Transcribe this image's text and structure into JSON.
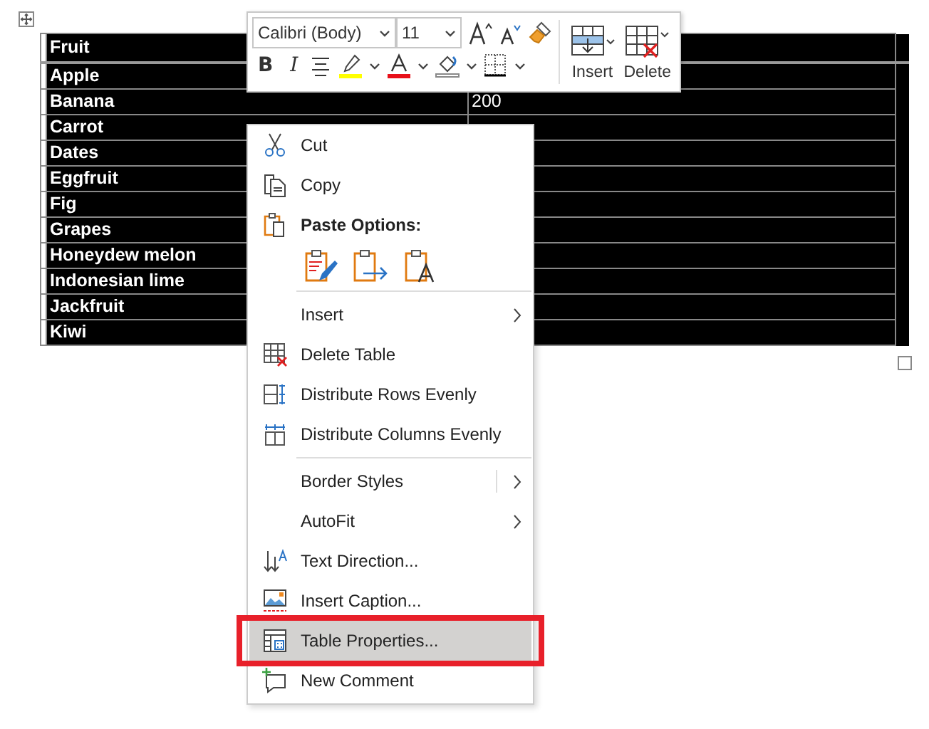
{
  "table": {
    "selected": true,
    "rows": [
      {
        "label": "Fruit",
        "header": true
      },
      {
        "label": "Apple",
        "header": false
      },
      {
        "label": "Banana",
        "header": false,
        "column_2": "200"
      },
      {
        "label": "Carrot",
        "header": false
      },
      {
        "label": "Dates",
        "header": false
      },
      {
        "label": "Eggfruit",
        "header": false
      },
      {
        "label": "Fig",
        "header": false
      },
      {
        "label": "Grapes",
        "header": false
      },
      {
        "label": "Honeydew melon",
        "header": false
      },
      {
        "label": "Indonesian lime",
        "header": false
      },
      {
        "label": "Jackfruit",
        "header": false
      },
      {
        "label": "Kiwi",
        "header": false
      }
    ]
  },
  "mini_toolbar": {
    "font": "Calibri (Body)",
    "size": "11",
    "bold": "B",
    "italic": "I",
    "insert": "Insert",
    "delete": "Delete"
  },
  "context_menu": {
    "items": [
      {
        "kind": "item",
        "label": "Cut",
        "submenu": false,
        "selected": false,
        "annotated": false
      },
      {
        "kind": "item",
        "label": "Copy",
        "submenu": false,
        "selected": false,
        "annotated": false
      },
      {
        "kind": "header",
        "label": "Paste Options:"
      },
      {
        "kind": "paste_icons"
      },
      {
        "kind": "separator"
      },
      {
        "kind": "item",
        "label": "Insert",
        "submenu": true,
        "selected": false,
        "annotated": false
      },
      {
        "kind": "item",
        "label": "Delete Table",
        "submenu": false,
        "selected": false,
        "annotated": false
      },
      {
        "kind": "item",
        "label": "Distribute Rows Evenly",
        "submenu": false,
        "selected": false,
        "annotated": false
      },
      {
        "kind": "item",
        "label": "Distribute Columns Evenly",
        "submenu": false,
        "selected": false,
        "annotated": false
      },
      {
        "kind": "separator"
      },
      {
        "kind": "item",
        "label": "Border Styles",
        "submenu": true,
        "split": true,
        "selected": false,
        "annotated": false
      },
      {
        "kind": "item",
        "label": "AutoFit",
        "submenu": true,
        "selected": false,
        "annotated": false
      },
      {
        "kind": "item",
        "label": "Text Direction...",
        "submenu": false,
        "selected": false,
        "annotated": false
      },
      {
        "kind": "item",
        "label": "Insert Caption...",
        "submenu": false,
        "selected": false,
        "annotated": false
      },
      {
        "kind": "item",
        "label": "Table Properties...",
        "submenu": false,
        "selected": true,
        "annotated": true
      },
      {
        "kind": "item",
        "label": "New Comment",
        "submenu": false,
        "selected": false,
        "annotated": false
      }
    ]
  }
}
